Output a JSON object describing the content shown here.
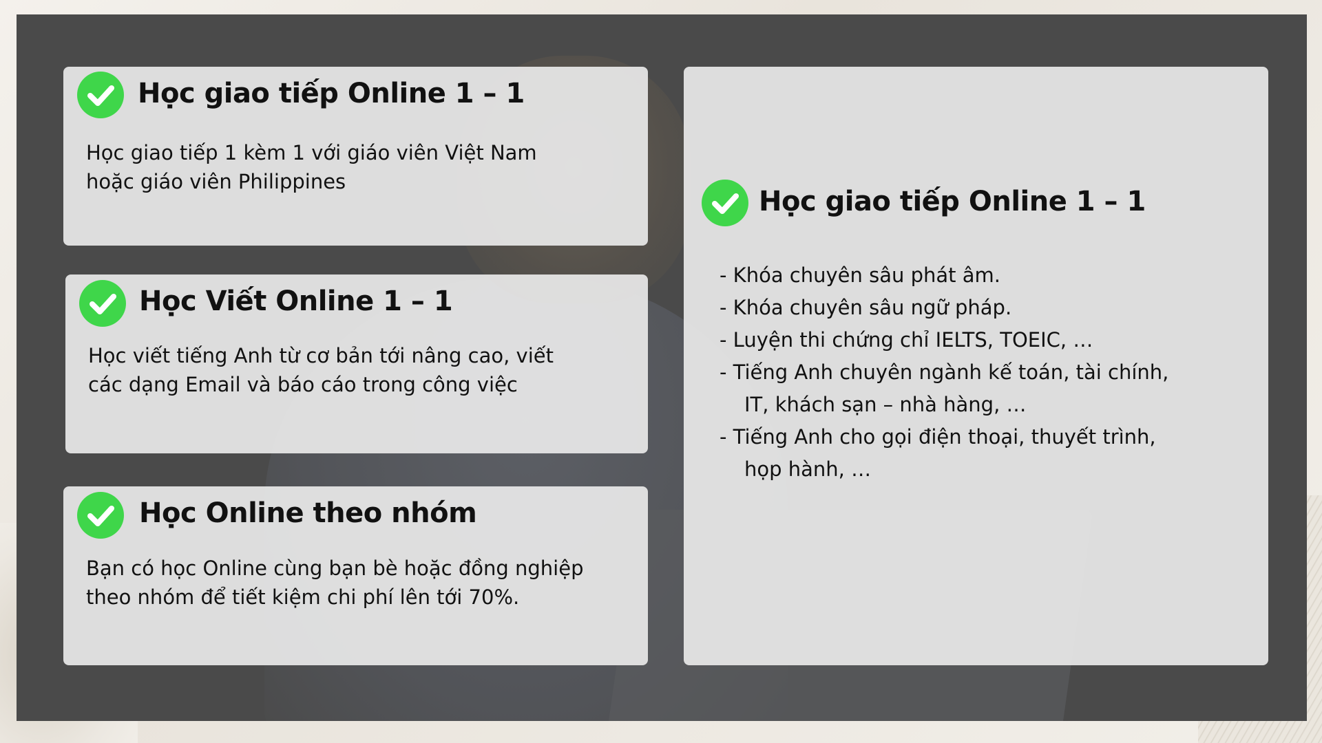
{
  "cards": [
    {
      "title": "Học giao tiếp Online 1 – 1",
      "text_lines": [
        "Học giao tiếp 1 kèm 1 với giáo viên Việt Nam",
        "hoặc giáo viên Philippines"
      ]
    },
    {
      "title": "Học Viết Online 1 – 1",
      "text_lines": [
        "Học viết tiếng Anh từ cơ bản tới nâng cao, viết",
        "các dạng Email và báo cáo trong công việc"
      ]
    },
    {
      "title": "Học Online theo nhóm",
      "text_lines": [
        "Bạn có học Online cùng bạn bè hoặc đồng nghiệp",
        "theo nhóm để tiết kiệm chi phí lên tới 70%."
      ]
    }
  ],
  "detail_card": {
    "title": "Học giao tiếp Online 1 – 1",
    "items": [
      {
        "line1": "- Khóa chuyên sâu phát âm.",
        "line2": ""
      },
      {
        "line1": "- Khóa chuyên sâu ngữ pháp.",
        "line2": ""
      },
      {
        "line1": "- Luyện thi chứng chỉ IELTS, TOEIC, …",
        "line2": ""
      },
      {
        "line1": "- Tiếng Anh chuyên ngành kế toán, tài chính,",
        "line2": "IT, khách sạn – nhà hàng, …"
      },
      {
        "line1": "- Tiếng Anh cho gọi điện thoại, thuyết trình,",
        "line2": "họp hành, …"
      }
    ]
  },
  "colors": {
    "frame": "#4a4a4a",
    "card": "#e8e8e8",
    "check": "#3fd64a"
  },
  "icons": {
    "check": "check-circle-icon"
  }
}
